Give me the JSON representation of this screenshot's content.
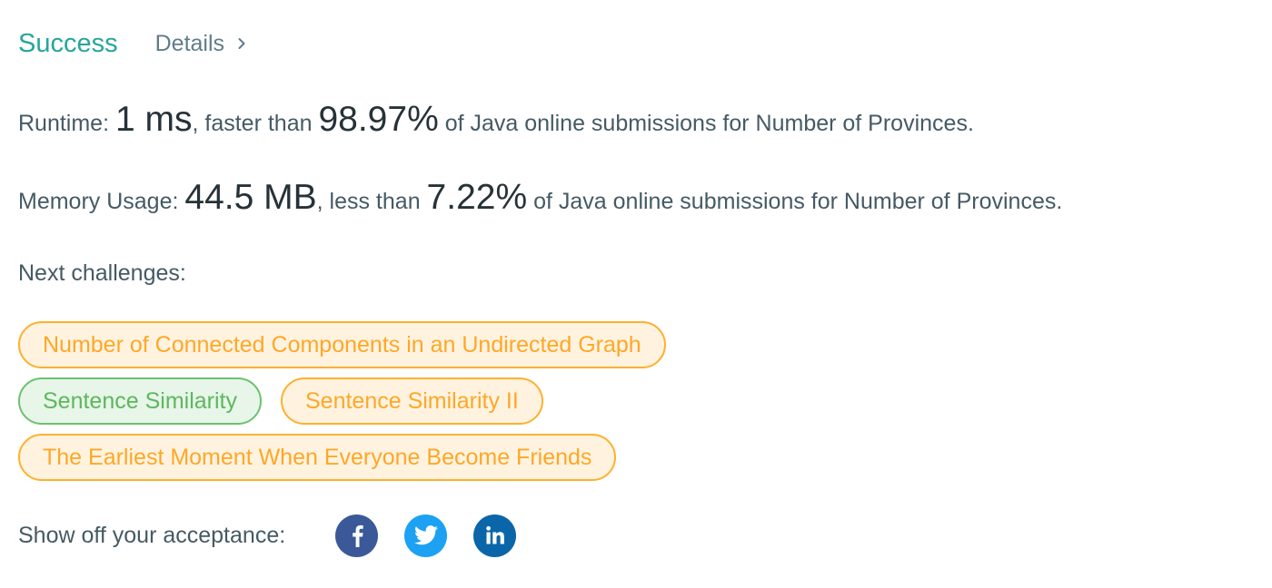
{
  "header": {
    "status": "Success",
    "details_label": "Details"
  },
  "runtime": {
    "label": "Runtime: ",
    "value": "1 ms",
    "comparison": ", faster than ",
    "percent": "98.97%",
    "suffix": " of Java online submissions for Number of Provinces."
  },
  "memory": {
    "label": "Memory Usage: ",
    "value": "44.5 MB",
    "comparison": ", less than ",
    "percent": "7.22%",
    "suffix": " of Java online submissions for Number of Provinces."
  },
  "next_challenges": {
    "label": "Next challenges:",
    "items": [
      {
        "title": "Number of Connected Components in an Undirected Graph",
        "difficulty": "medium"
      },
      {
        "title": "Sentence Similarity",
        "difficulty": "easy"
      },
      {
        "title": "Sentence Similarity II",
        "difficulty": "medium"
      },
      {
        "title": "The Earliest Moment When Everyone Become Friends",
        "difficulty": "medium"
      }
    ]
  },
  "share": {
    "label": "Show off your acceptance:",
    "icons": [
      "facebook-icon",
      "twitter-icon",
      "linkedin-icon"
    ]
  },
  "colors": {
    "success": "#26a69a",
    "medium": "#ffa726",
    "easy": "#5cb85c",
    "facebook": "#3b5998",
    "twitter": "#1da1f2",
    "linkedin": "#0a66a8"
  }
}
